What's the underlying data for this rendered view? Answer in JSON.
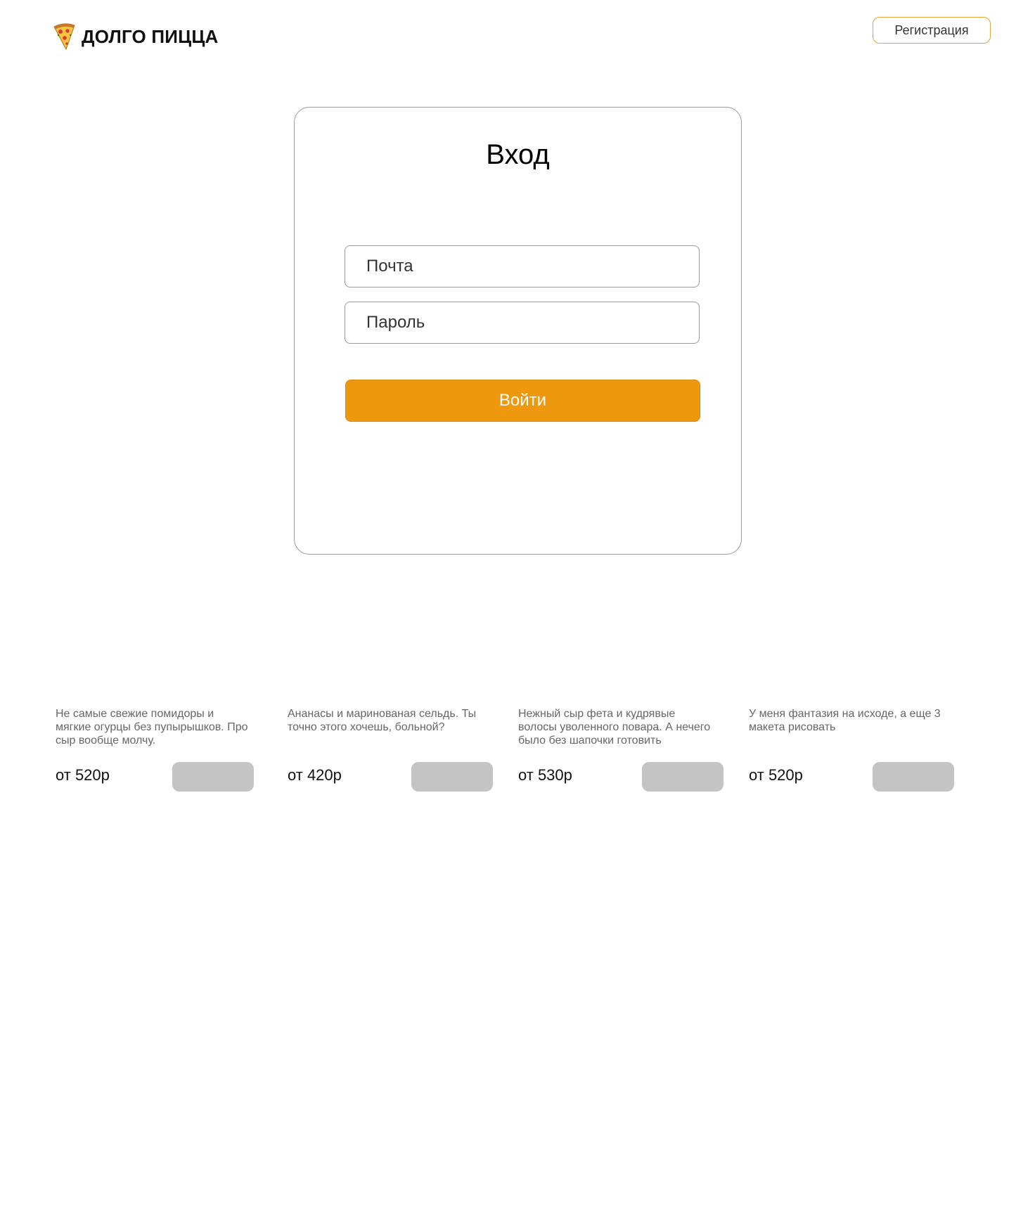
{
  "header": {
    "logo_text": "ДОЛГО ПИЦЦА",
    "logo_icon": "pizza-slice-icon",
    "register_label": "Регистрация"
  },
  "login": {
    "title": "Вход",
    "email_placeholder": "Почта",
    "password_placeholder": "Пароль",
    "submit_label": "Войти"
  },
  "products": [
    {
      "description": "Не самые свежие помидоры и мягкие огурцы без пупырышков. Про сыр вообще молчу.",
      "price": "от 520р"
    },
    {
      "description": "Ананасы и маринованая сельдь. Ты точно этого хочешь, больной?",
      "price": "от 420р"
    },
    {
      "description": "Нежный сыр фета и кудрявые волосы уволенного повара. А нечего было без шапочки готовить",
      "price": "от 530р"
    },
    {
      "description": "У меня фантазия на исходе, а еще 3 макета рисовать",
      "price": "от 520р"
    }
  ],
  "colors": {
    "accent": "#f0980d",
    "register_border": "#e9a233",
    "placeholder_button": "#c4c4c4",
    "border_gray": "#9a9a9a"
  }
}
